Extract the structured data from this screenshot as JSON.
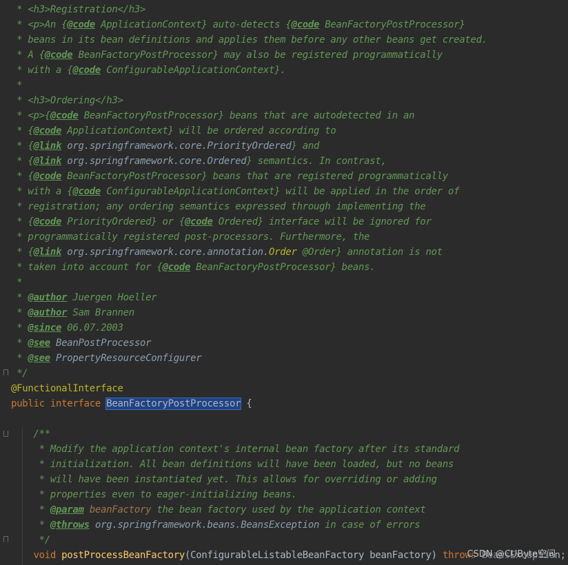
{
  "editor": {
    "language": "java",
    "colors": {
      "background": "#2b2b2b",
      "doc_comment": "#629755",
      "keyword": "#cc7832",
      "annotation": "#bbb529",
      "plain": "#a9b7c6",
      "method": "#ffc66d",
      "selection": "#214283"
    },
    "lines": [
      [
        [
          "doc",
          " * "
        ],
        [
          "html",
          "<h3>"
        ],
        [
          "doc",
          "Registration"
        ],
        [
          "html",
          "</h3>"
        ]
      ],
      [
        [
          "doc",
          " * "
        ],
        [
          "html",
          "<p>"
        ],
        [
          "doc",
          "An {"
        ],
        [
          "tag",
          "@code"
        ],
        [
          "doc",
          " ApplicationContext} auto-detects {"
        ],
        [
          "tag",
          "@code"
        ],
        [
          "doc",
          " BeanFactoryPostProcessor}"
        ]
      ],
      [
        [
          "doc",
          " * beans in its bean definitions and applies them before any other beans get created."
        ]
      ],
      [
        [
          "doc",
          " * A {"
        ],
        [
          "tag",
          "@code"
        ],
        [
          "doc",
          " BeanFactoryPostProcessor} may also be registered programmatically"
        ]
      ],
      [
        [
          "doc",
          " * with a {"
        ],
        [
          "tag",
          "@code"
        ],
        [
          "doc",
          " ConfigurableApplicationContext}."
        ]
      ],
      [
        [
          "doc",
          " *"
        ]
      ],
      [
        [
          "doc",
          " * "
        ],
        [
          "html",
          "<h3>"
        ],
        [
          "doc",
          "Ordering"
        ],
        [
          "html",
          "</h3>"
        ]
      ],
      [
        [
          "doc",
          " * "
        ],
        [
          "html",
          "<p>"
        ],
        [
          "doc",
          "{"
        ],
        [
          "tag",
          "@code"
        ],
        [
          "doc",
          " BeanFactoryPostProcessor} beans that are autodetected in an"
        ]
      ],
      [
        [
          "doc",
          " * {"
        ],
        [
          "tag",
          "@code"
        ],
        [
          "doc",
          " ApplicationContext} will be ordered according to"
        ]
      ],
      [
        [
          "doc",
          " * {"
        ],
        [
          "tag",
          "@link"
        ],
        [
          "link",
          " org.springframework.core.PriorityOrdered"
        ],
        [
          "doc",
          "} and"
        ]
      ],
      [
        [
          "doc",
          " * {"
        ],
        [
          "tag",
          "@link"
        ],
        [
          "link",
          " org.springframework.core.Ordered"
        ],
        [
          "doc",
          "} semantics. In contrast,"
        ]
      ],
      [
        [
          "doc",
          " * {"
        ],
        [
          "tag",
          "@code"
        ],
        [
          "doc",
          " BeanFactoryPostProcessor} beans that are registered programmatically"
        ]
      ],
      [
        [
          "doc",
          " * with a {"
        ],
        [
          "tag",
          "@code"
        ],
        [
          "doc",
          " ConfigurableApplicationContext} will be applied in the order of"
        ]
      ],
      [
        [
          "doc",
          " * registration; any ordering semantics expressed through implementing the"
        ]
      ],
      [
        [
          "doc",
          " * {"
        ],
        [
          "tag",
          "@code"
        ],
        [
          "doc",
          " PriorityOrdered} or {"
        ],
        [
          "tag",
          "@code"
        ],
        [
          "doc",
          " Ordered} interface will be ignored for"
        ]
      ],
      [
        [
          "doc",
          " * programmatically registered post-processors. Furthermore, the"
        ]
      ],
      [
        [
          "doc",
          " * {"
        ],
        [
          "tag",
          "@link"
        ],
        [
          "link",
          " org.springframework.core.annotation."
        ],
        [
          "ordername",
          "Order"
        ],
        [
          "doc",
          " @Order} annotation is not"
        ]
      ],
      [
        [
          "doc",
          " * taken into account for {"
        ],
        [
          "tag",
          "@code"
        ],
        [
          "doc",
          " BeanFactoryPostProcessor} beans."
        ]
      ],
      [
        [
          "doc",
          " *"
        ]
      ],
      [
        [
          "doc",
          " * "
        ],
        [
          "tag",
          "@author"
        ],
        [
          "doc",
          " Juergen Hoeller"
        ]
      ],
      [
        [
          "doc",
          " * "
        ],
        [
          "tag",
          "@author"
        ],
        [
          "doc",
          " Sam Brannen"
        ]
      ],
      [
        [
          "doc",
          " * "
        ],
        [
          "tag",
          "@since"
        ],
        [
          "doc",
          " 06.07.2003"
        ]
      ],
      [
        [
          "doc",
          " * "
        ],
        [
          "tag",
          "@see"
        ],
        [
          "link",
          " BeanPostProcessor"
        ]
      ],
      [
        [
          "doc",
          " * "
        ],
        [
          "tag",
          "@see"
        ],
        [
          "link",
          " PropertyResourceConfigurer"
        ]
      ],
      [
        [
          "doc",
          " */"
        ]
      ],
      [
        [
          "ann",
          "@FunctionalInterface"
        ]
      ],
      [
        [
          "kw",
          "public interface "
        ],
        [
          "sel",
          "BeanFactoryPostProcessor"
        ],
        [
          "plain",
          " {"
        ]
      ],
      [
        [
          "plain",
          ""
        ]
      ],
      [
        [
          "doc",
          "    /**"
        ]
      ],
      [
        [
          "doc",
          "     * Modify the application context's internal bean factory after its standard"
        ]
      ],
      [
        [
          "doc",
          "     * initialization. All bean definitions will have been loaded, but no beans"
        ]
      ],
      [
        [
          "doc",
          "     * will have been instantiated yet. This allows for overriding or adding"
        ]
      ],
      [
        [
          "doc",
          "     * properties even to eager-initializing beans."
        ]
      ],
      [
        [
          "doc",
          "     * "
        ],
        [
          "tag",
          "@param"
        ],
        [
          "paramname",
          " beanFactory"
        ],
        [
          "doc",
          " the bean factory used by the application context"
        ]
      ],
      [
        [
          "doc",
          "     * "
        ],
        [
          "tag",
          "@throws"
        ],
        [
          "link",
          " org.springframework.beans.BeansException"
        ],
        [
          "doc",
          " in case of errors"
        ]
      ],
      [
        [
          "doc",
          "     */"
        ]
      ],
      [
        [
          "kw",
          "    void "
        ],
        [
          "method",
          "postProcessBeanFactory"
        ],
        [
          "plain",
          "(ConfigurableListableBeanFactory beanFactory) "
        ],
        [
          "kw",
          "throws"
        ],
        [
          "plain",
          " BeansException;"
        ]
      ]
    ]
  },
  "watermark": "CSDN @CUByte空间"
}
